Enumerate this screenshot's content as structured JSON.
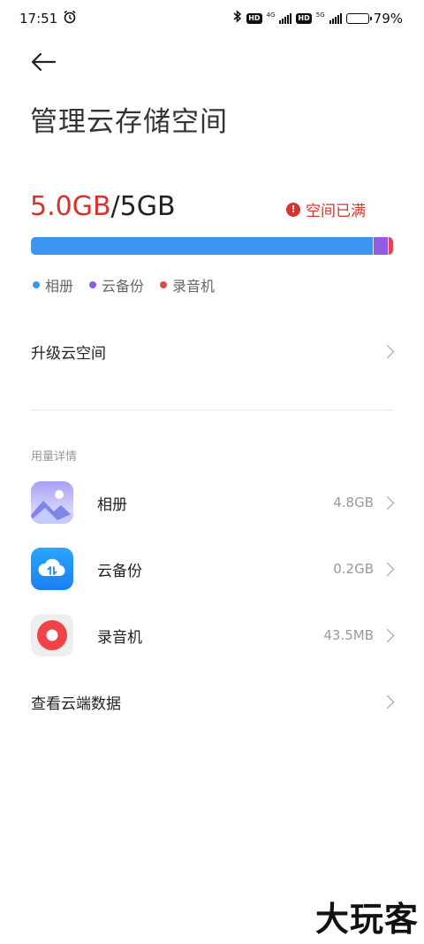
{
  "status_bar": {
    "time": "17:51",
    "battery": "79%",
    "battery_level": 0.79,
    "hd1": "HD",
    "net1": "4G",
    "hd2": "HD",
    "net2": "5G"
  },
  "header": {
    "title": "管理云存储空间"
  },
  "storage": {
    "used": "5.0GB",
    "separator": "/",
    "total": "5GB",
    "status": "空间已满",
    "segments": [
      {
        "name": "相册",
        "value_gb": 4.8,
        "color": "#3d95f2"
      },
      {
        "name": "云备份",
        "value_gb": 0.2,
        "color": "#8f5ce8"
      },
      {
        "name": "录音机",
        "value_gb": 0.0435,
        "color": "#e0494c"
      }
    ]
  },
  "legend": [
    {
      "label": "相册",
      "color": "#3d95f2"
    },
    {
      "label": "云备份",
      "color": "#8f5ce8"
    },
    {
      "label": "录音机",
      "color": "#e0494c"
    }
  ],
  "upgrade": {
    "label": "升级云空间"
  },
  "details": {
    "section_label": "用量详情",
    "items": [
      {
        "name": "相册",
        "size": "4.8GB",
        "icon": "gallery-icon"
      },
      {
        "name": "云备份",
        "size": "0.2GB",
        "icon": "cloud-backup-icon"
      },
      {
        "name": "录音机",
        "size": "43.5MB",
        "icon": "recorder-icon"
      }
    ]
  },
  "view_cloud": {
    "label": "查看云端数据"
  },
  "watermark": "大玩客"
}
